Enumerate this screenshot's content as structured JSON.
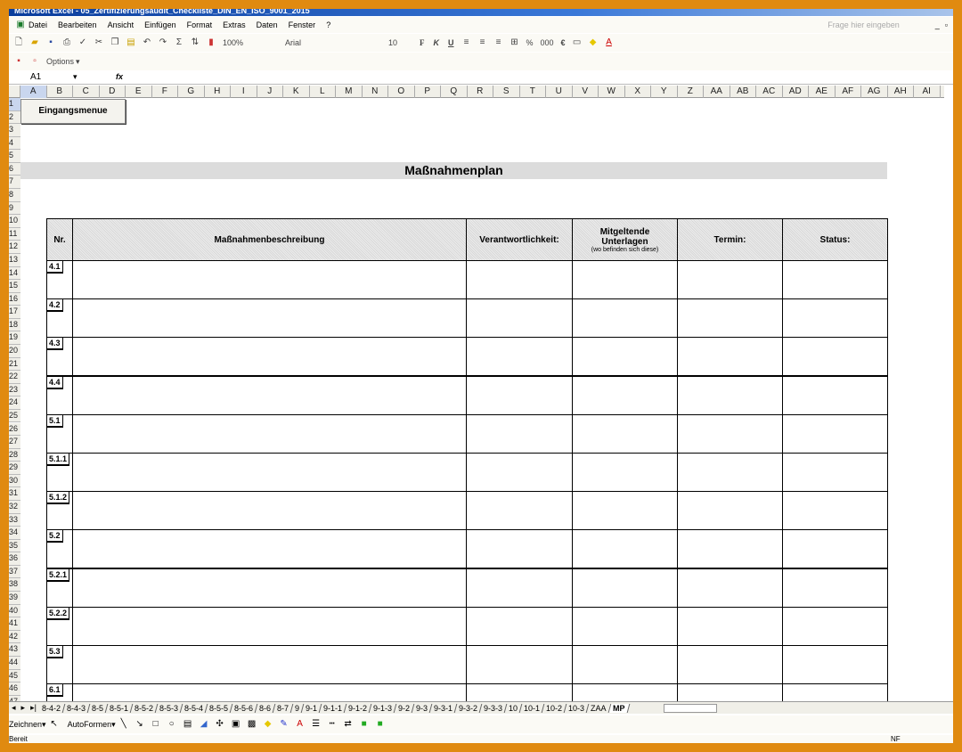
{
  "window": {
    "title": "Microsoft Excel - 05_Zertifizierungsaudit_Checkliste_DIN_EN_ISO_9001_2015",
    "help_placeholder": "Frage hier eingeben"
  },
  "menu": [
    "Datei",
    "Bearbeiten",
    "Ansicht",
    "Einfügen",
    "Format",
    "Extras",
    "Daten",
    "Fenster",
    "?"
  ],
  "toolbar": {
    "zoom": "100%",
    "font": "Arial",
    "size": "10",
    "bold": "F",
    "italic": "K",
    "underline": "U",
    "percent": "%",
    "thousands": "000",
    "euro": "€"
  },
  "options_label": "Options",
  "formula": {
    "cell_ref": "A1",
    "fx": "fx",
    "value": ""
  },
  "columns": [
    "A",
    "B",
    "C",
    "D",
    "E",
    "F",
    "G",
    "H",
    "I",
    "J",
    "K",
    "L",
    "M",
    "N",
    "O",
    "P",
    "Q",
    "R",
    "S",
    "T",
    "U",
    "V",
    "W",
    "X",
    "Y",
    "Z",
    "AA",
    "AB",
    "AC",
    "AD",
    "AE",
    "AF",
    "AG",
    "AH",
    "AI"
  ],
  "rows": [
    "1",
    "2",
    "3",
    "4",
    "5",
    "6",
    "7",
    "8",
    "9",
    "10",
    "11",
    "12",
    "13",
    "14",
    "15",
    "16",
    "17",
    "18",
    "19",
    "20",
    "21",
    "22",
    "23",
    "24",
    "25",
    "26",
    "27",
    "28",
    "29",
    "30",
    "31",
    "32",
    "33",
    "34",
    "35",
    "36",
    "37",
    "38",
    "39",
    "40",
    "41",
    "42",
    "43",
    "44",
    "45",
    "46",
    "47"
  ],
  "sheet": {
    "button": "Eingangsmenue",
    "title": "Maßnahmenplan",
    "headers": {
      "nr": "Nr.",
      "desc": "Maßnahmenbeschreibung",
      "resp": "Verantwortlichkeit:",
      "docs": "Mitgeltende Unterlagen",
      "docs_sub": "(wo befinden sich diese)",
      "date": "Termin:",
      "status": "Status:"
    },
    "items": [
      "4.1",
      "4.2",
      "4.3",
      "4.4",
      "5.1",
      "5.1.1",
      "5.1.2",
      "5.2",
      "5.2.1",
      "5.2.2",
      "5.3",
      "6.1"
    ]
  },
  "tabs": [
    "8-4-2",
    "8-4-3",
    "8-5",
    "8-5-1",
    "8-5-2",
    "8-5-3",
    "8-5-4",
    "8-5-5",
    "8-5-6",
    "8-6",
    "8-7",
    "9",
    "9-1",
    "9-1-1",
    "9-1-2",
    "9-1-3",
    "9-2",
    "9-3",
    "9-3-1",
    "9-3-2",
    "9-3-3",
    "10",
    "10-1",
    "10-2",
    "10-3",
    "ZAA",
    "MP"
  ],
  "active_tab": "MP",
  "drawing": {
    "draw": "Zeichnen",
    "autoshapes": "AutoFormen"
  },
  "status": {
    "left": "Bereit",
    "right": "NF"
  }
}
